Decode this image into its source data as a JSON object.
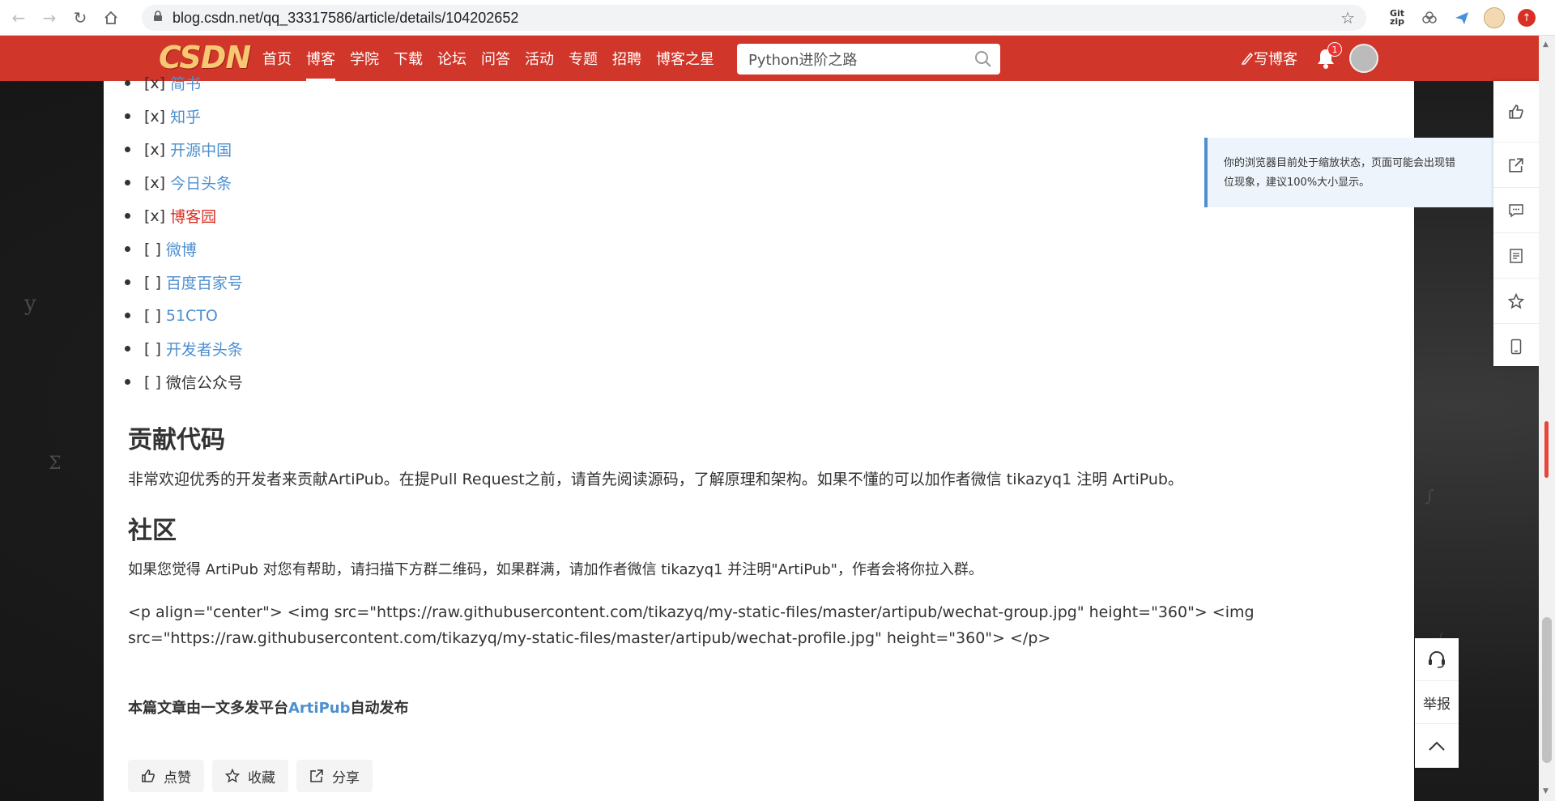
{
  "browser": {
    "url": "blog.csdn.net/qq_33317586/article/details/104202652",
    "extensions": {
      "gitzip": "Git zip"
    }
  },
  "header": {
    "logo": "CSDN",
    "nav": [
      "首页",
      "博客",
      "学院",
      "下载",
      "论坛",
      "问答",
      "活动",
      "专题",
      "招聘",
      "博客之星"
    ],
    "active_nav": "博客",
    "search_value": "Python进阶之路",
    "write_blog": "写博客",
    "notification_count": "1"
  },
  "article": {
    "platforms": [
      {
        "mark": "[x]",
        "name": "简书",
        "linked": true
      },
      {
        "mark": "[x]",
        "name": "知乎",
        "linked": true
      },
      {
        "mark": "[x]",
        "name": "开源中国",
        "linked": true
      },
      {
        "mark": "[x]",
        "name": "今日头条",
        "linked": true
      },
      {
        "mark": "[x]",
        "name": "博客园",
        "linked": true
      },
      {
        "mark": "[ ]",
        "name": "微博",
        "linked": true
      },
      {
        "mark": "[ ]",
        "name": "百度百家号",
        "linked": true
      },
      {
        "mark": "[ ]",
        "name": "51CTO",
        "linked": true
      },
      {
        "mark": "[ ]",
        "name": "开发者头条",
        "linked": true
      },
      {
        "mark": "[ ]",
        "name": "微信公众号",
        "linked": false
      }
    ],
    "contribute_heading": "贡献代码",
    "contribute_text": "非常欢迎优秀的开发者来贡献ArtiPub。在提Pull Request之前，请首先阅读源码，了解原理和架构。如果不懂的可以加作者微信 tikazyq1 注明 ArtiPub。",
    "community_heading": "社区",
    "community_text": "如果您觉得 ArtiPub 对您有帮助，请扫描下方群二维码，如果群满，请加作者微信 tikazyq1 并注明\"ArtiPub\"，作者会将你拉入群。",
    "code_line1": "<p align=\"center\"> <img src=\"https://raw.githubusercontent.com/tikazyq/my-static-files/master/artipub/wechat-group.jpg\" height=\"360\"> <img",
    "code_line2": "src=\"https://raw.githubusercontent.com/tikazyq/my-static-files/master/artipub/wechat-profile.jpg\" height=\"360\"> </p>",
    "footer_prefix": "本篇文章由一文多发平台",
    "footer_link": "ArtiPub",
    "footer_suffix": "自动发布",
    "actions": {
      "like": "点赞",
      "collect": "收藏",
      "share": "分享"
    }
  },
  "zoom_tip": {
    "line1": "你的浏览器目前处于缩放状态，页面可能会出现错",
    "line2": "位现象，建议100%大小显示。"
  },
  "side_tools": {
    "report": "举报"
  }
}
